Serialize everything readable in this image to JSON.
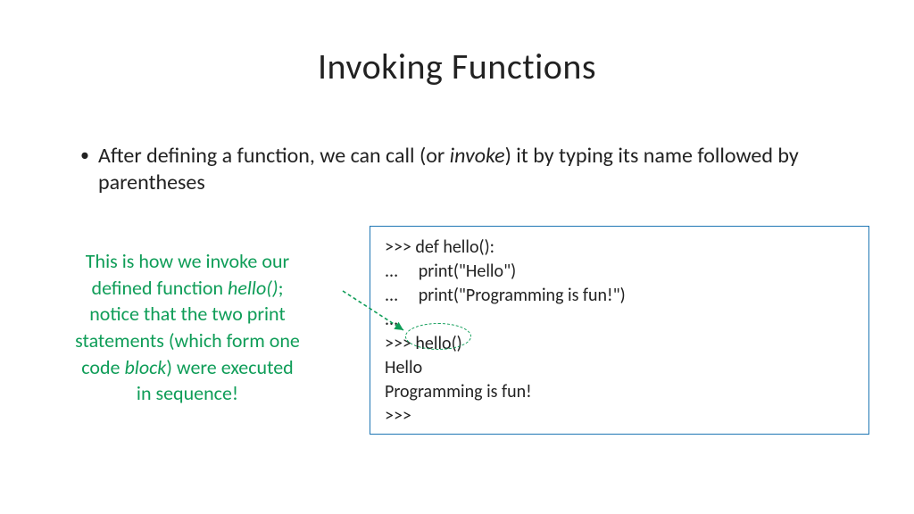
{
  "title": "Invoking Functions",
  "bullet": {
    "pre": "After defining a function, we can call (or ",
    "italic": "invoke",
    "post": ") it by typing its name followed by parentheses"
  },
  "annotation": {
    "l1": "This is how we invoke our",
    "l2a": "defined function ",
    "l2i": "hello()",
    "l2b": ";",
    "l3": "notice that the two print",
    "l4": "statements (which form one",
    "l5a": "code ",
    "l5i": "block",
    "l5b": ") were executed",
    "l6": "in sequence!"
  },
  "code": {
    "l1": ">>> def hello():",
    "l2": "...     print(\"Hello\")",
    "l3": "...     print(\"Programming is fun!\")",
    "l4": "...",
    "l5": ">>> hello()",
    "l6": "Hello",
    "l7": "Programming is fun!",
    "l8": ">>>"
  }
}
